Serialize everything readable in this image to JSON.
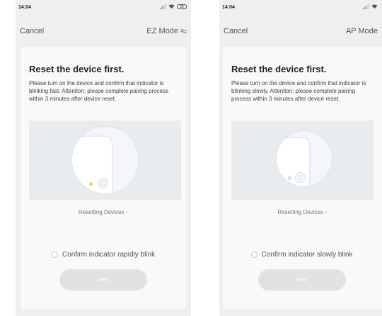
{
  "screens": [
    {
      "status_time": "14:04",
      "battery": "95",
      "cancel_label": "Cancel",
      "mode_label": "EZ Mode",
      "mode_icon": "switch-icon",
      "title": "Reset the device first.",
      "description": "Please turn on the device and confirm that indicator is blinking fast. Attention: please complete pairing process within 3 minutes after device reset.",
      "indicator_state": "blinking fast",
      "led_color": "#f4d63a",
      "resetting_link": "Resetting Devices",
      "confirm_label": "Confirm indicator rapidly blink",
      "next_label": "Next"
    },
    {
      "status_time": "14:04",
      "cancel_label": "Cancel",
      "mode_label": "AP Mode",
      "title": "Reset the device first.",
      "description": "Please turn on the device and confirm that indicator is blinking slowly. Attention: please complete pairing process within 3 minutes after device reset.",
      "indicator_state": "blinking slowly",
      "resetting_link": "Resetting Devices",
      "confirm_label": "Confirm indicator slowly blink",
      "next_label": "Next"
    }
  ]
}
